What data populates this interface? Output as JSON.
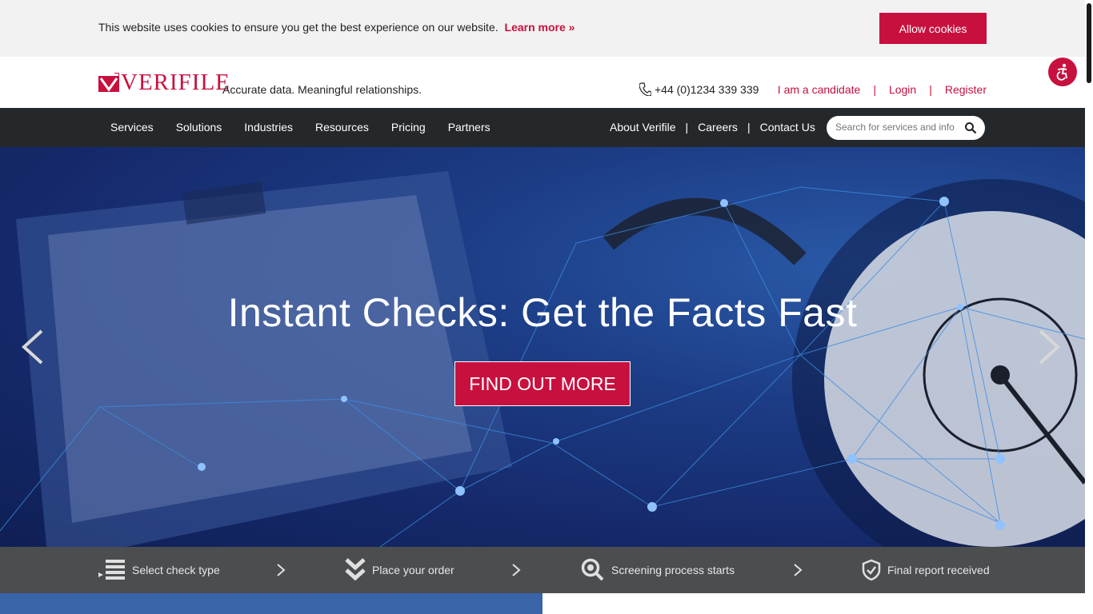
{
  "cookie_bar": {
    "message": "This website uses cookies to ensure you get the best experience on our website.",
    "learn_more": "Learn more  »",
    "allow_label": "Allow cookies"
  },
  "header": {
    "logo_text": "VERIFILE",
    "tagline": "Accurate data. Meaningful relationships.",
    "phone": "+44 (0)1234 339 339",
    "links": [
      "I am a candidate",
      "Login",
      "Register"
    ],
    "link_separator": "|"
  },
  "nav": {
    "left_items": [
      "Services",
      "Solutions",
      "Industries",
      "Resources",
      "Pricing",
      "Partners"
    ],
    "right_items": [
      "About Verifile",
      "Careers",
      "Contact Us"
    ],
    "separator": "|",
    "search_placeholder": "Search for services and info"
  },
  "hero": {
    "title": "Instant Checks: Get the Facts Fast",
    "cta_label": "FIND OUT MORE"
  },
  "steps": [
    {
      "label": "Select check type",
      "icon": "list-icon"
    },
    {
      "label": "Place your order",
      "icon": "double-chevron-down-icon"
    },
    {
      "label": "Screening process starts",
      "icon": "magnifier-icon"
    },
    {
      "label": "Final report received",
      "icon": "shield-check-icon"
    }
  ],
  "colors": {
    "accent": "#c8103e",
    "nav_bg": "#25282b",
    "steps_bg": "#4b4d4f",
    "hero_bg": "#1c3c85"
  }
}
